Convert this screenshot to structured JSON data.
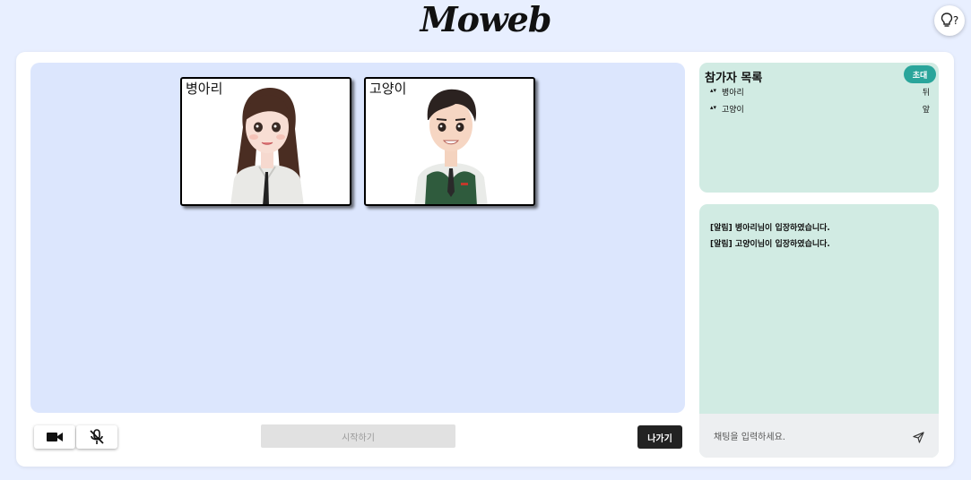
{
  "app": {
    "logo": "Moweb",
    "hint_label": "?"
  },
  "stage": {
    "tiles": [
      {
        "name": "병아리"
      },
      {
        "name": "고양이"
      }
    ]
  },
  "controls": {
    "camera_icon": "video-camera-icon",
    "mic_icon": "mic-off-icon",
    "start_label": "시작하기",
    "leave_label": "나가기"
  },
  "participants": {
    "title": "참가자 목록",
    "invite_label": "초대",
    "items": [
      {
        "name": "병아리",
        "tag": "뒤"
      },
      {
        "name": "고양이",
        "tag": "앞"
      }
    ]
  },
  "chat": {
    "messages": [
      "[알림] 병아리님이 입장하였습니다.",
      "[알림] 고양이님이 입장하였습니다."
    ],
    "input_placeholder": "채팅을 입력하세요.",
    "input_value": ""
  },
  "colors": {
    "background": "#e8efff",
    "stage": "#dce6fd",
    "panel": "#d1ebe3",
    "accent": "#2aa59b",
    "leave": "#222222"
  }
}
